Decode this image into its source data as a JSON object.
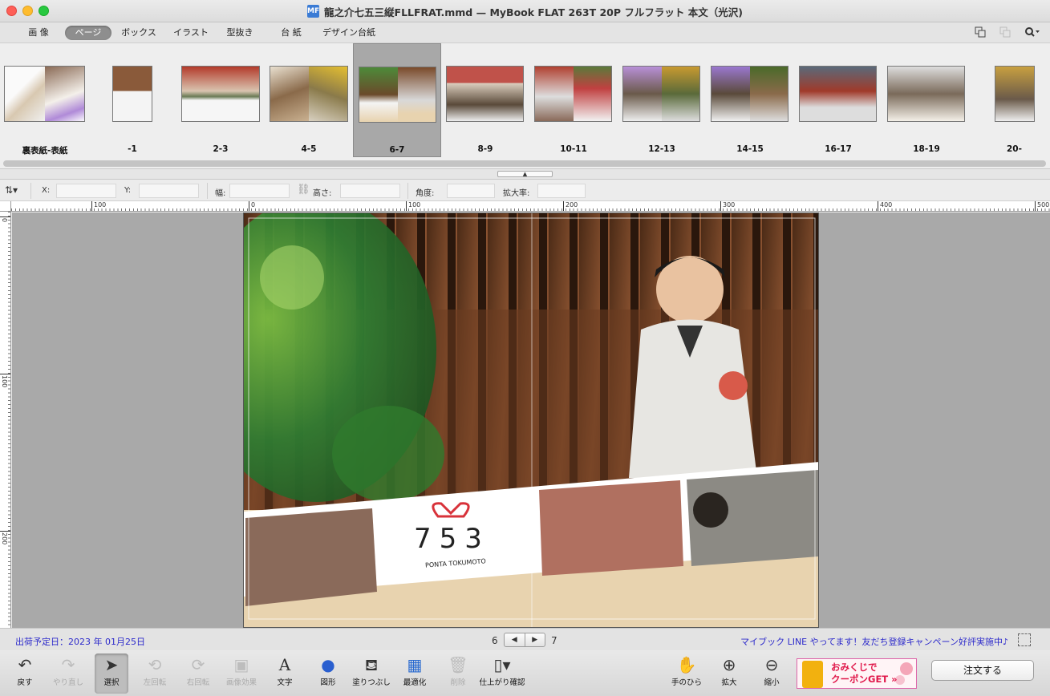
{
  "window": {
    "title": "龍之介七五三縦FLLFRAT.mmd — MyBook FLAT 263T 20P フルフラット 本文（光沢)",
    "doc_icon": "MF"
  },
  "category_tabs": [
    {
      "label": "画 像",
      "active": false
    },
    {
      "label": "ページ",
      "active": true
    },
    {
      "label": "ボックス",
      "active": false
    },
    {
      "label": "イラスト",
      "active": false
    },
    {
      "label": "型抜き",
      "active": false
    },
    {
      "label": "台 紙",
      "active": false
    },
    {
      "label": "デザイン台紙",
      "active": false
    }
  ],
  "toolbar_icons": [
    "duplicate-page-icon",
    "delete-page-icon",
    "search-icon"
  ],
  "pages": [
    {
      "label": "裏表紙-表紙",
      "selected": false
    },
    {
      "label": "-1",
      "selected": false
    },
    {
      "label": "2-3",
      "selected": false
    },
    {
      "label": "4-5",
      "selected": false
    },
    {
      "label": "6-7",
      "selected": true
    },
    {
      "label": "8-9",
      "selected": false
    },
    {
      "label": "10-11",
      "selected": false
    },
    {
      "label": "12-13",
      "selected": false
    },
    {
      "label": "14-15",
      "selected": false
    },
    {
      "label": "16-17",
      "selected": false
    },
    {
      "label": "18-19",
      "selected": false
    },
    {
      "label": "20-",
      "selected": false
    }
  ],
  "properties": {
    "x_label": "X:",
    "y_label": "Y:",
    "width_label": "幅:",
    "height_label": "高さ:",
    "angle_label": "角度:",
    "scale_label": "拡大率:"
  },
  "ruler": {
    "top_labels": [
      "100",
      "0",
      "100",
      "200",
      "300",
      "400",
      "500"
    ],
    "left_labels": [
      "0",
      "100",
      "200"
    ]
  },
  "spread_title": {
    "number": "753",
    "name": "PONTA TOKUMOTO"
  },
  "status": {
    "ship_date": "出荷予定日：2023 年 01月25日",
    "page_left": "6",
    "page_right": "7",
    "prev_label": "◀",
    "next_label": "▶",
    "promo": "マイブック LINE やってます！友だち登録キャンペーン好評実施中♪"
  },
  "tools": [
    {
      "label": "戻す",
      "icon": "undo-icon",
      "enabled": true
    },
    {
      "label": "やり直し",
      "icon": "redo-icon",
      "enabled": false
    },
    {
      "label": "選択",
      "icon": "pointer-icon",
      "enabled": true,
      "active": true
    },
    {
      "label": "左回転",
      "icon": "rotate-left-icon",
      "enabled": false
    },
    {
      "label": "右回転",
      "icon": "rotate-right-icon",
      "enabled": false
    },
    {
      "label": "画像効果",
      "icon": "image-effect-icon",
      "enabled": false
    },
    {
      "label": "文字",
      "icon": "text-icon",
      "enabled": true
    },
    {
      "label": "図形",
      "icon": "shape-icon",
      "enabled": true
    },
    {
      "label": "塗りつぶし",
      "icon": "fill-icon",
      "enabled": true
    },
    {
      "label": "最適化",
      "icon": "optimize-icon",
      "enabled": true
    },
    {
      "label": "削除",
      "icon": "trash-icon",
      "enabled": false
    },
    {
      "label": "仕上がり確認",
      "icon": "book-preview-icon",
      "enabled": true
    },
    {
      "label": "手のひら",
      "icon": "hand-icon",
      "enabled": true
    },
    {
      "label": "拡大",
      "icon": "zoom-in-icon",
      "enabled": true
    },
    {
      "label": "縮小",
      "icon": "zoom-out-icon",
      "enabled": true
    }
  ],
  "coupon": {
    "text": "おみくじで\nクーポンGET »"
  },
  "order_button": "注文する",
  "colors": {
    "link_blue": "#2d2acb",
    "selected_tab": "#8e8e8e",
    "canvas_bg": "#a9a9a9"
  }
}
